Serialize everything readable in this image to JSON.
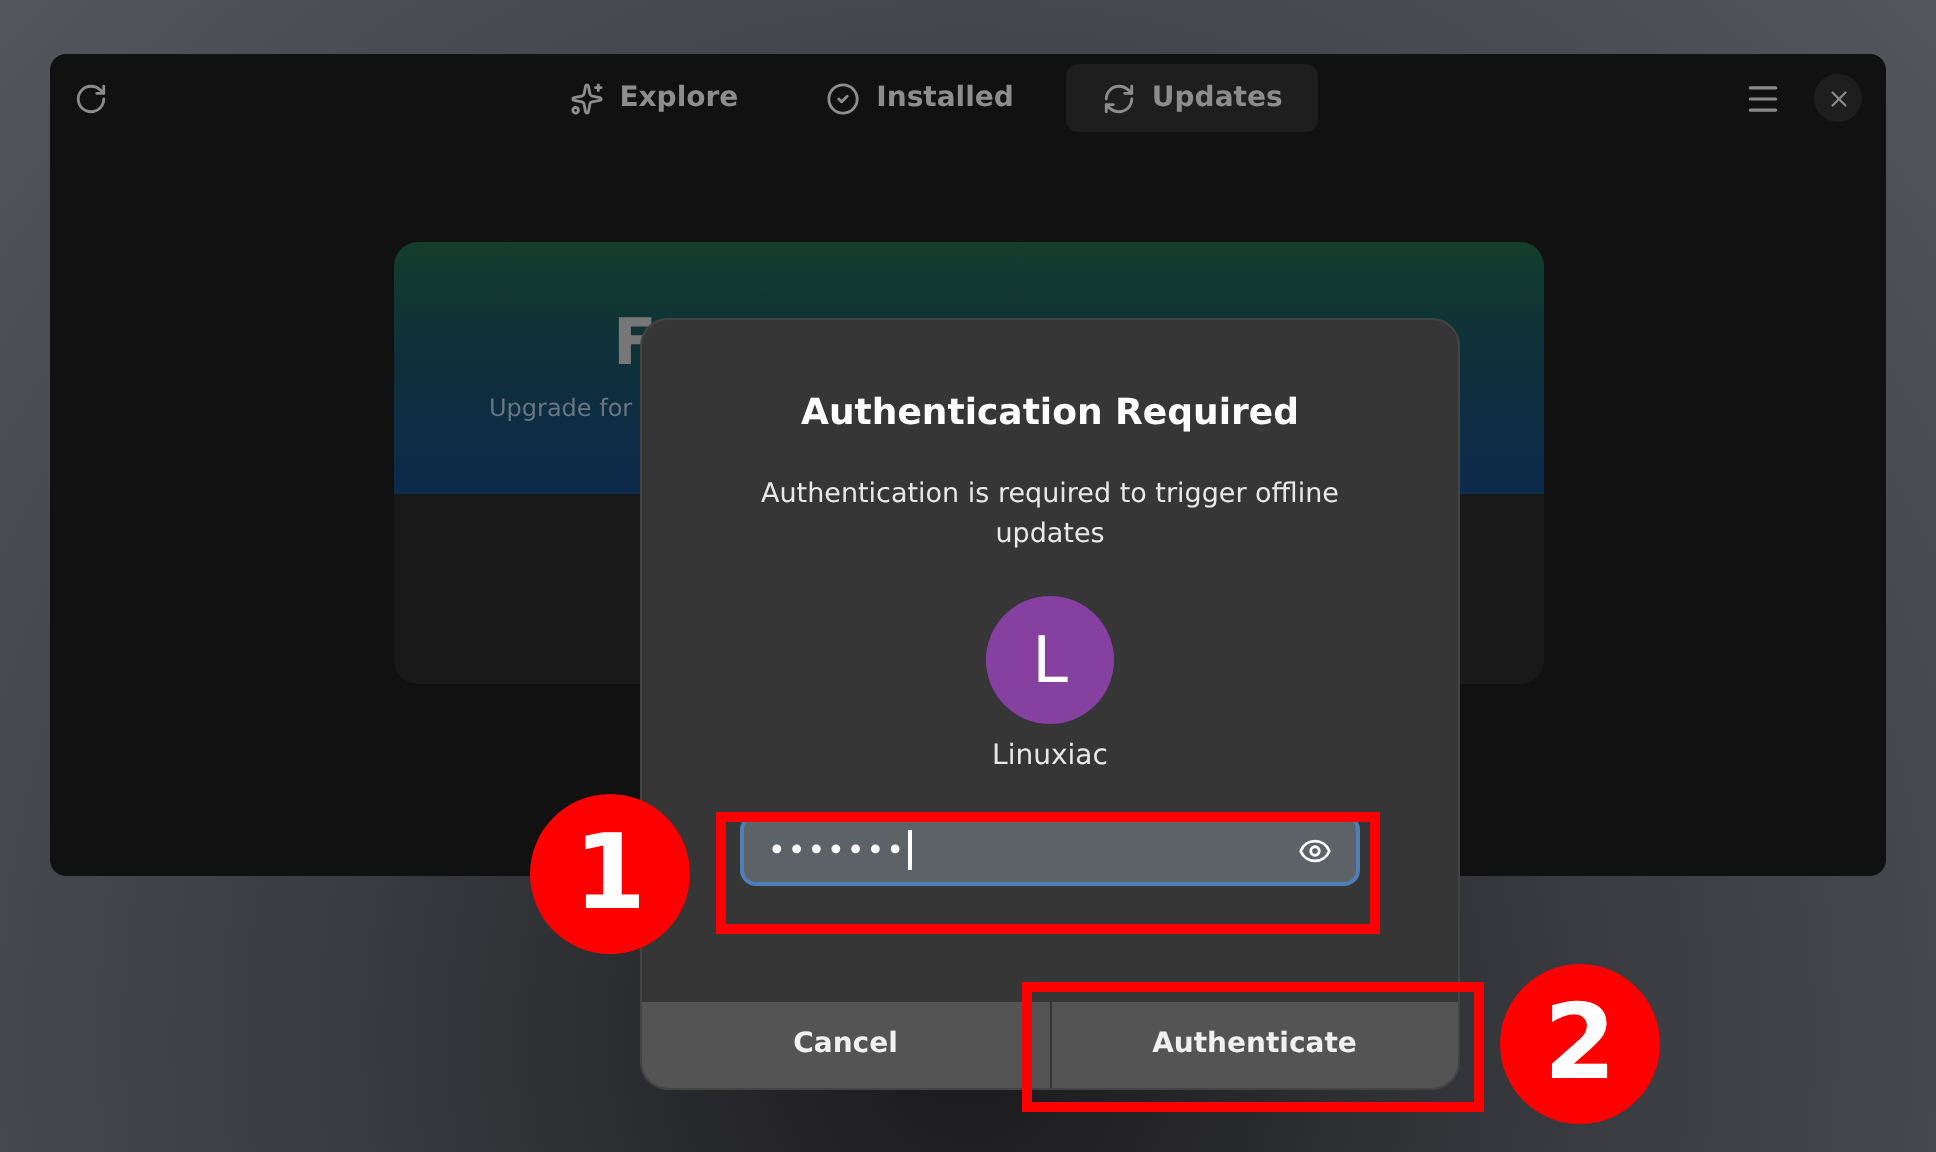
{
  "window": {
    "tabs": [
      {
        "label": "Explore",
        "selected": false
      },
      {
        "label": "Installed",
        "selected": false
      },
      {
        "label": "Updates",
        "selected": true
      }
    ],
    "banner": {
      "title": "F",
      "subtitle": "Upgrade for"
    }
  },
  "dialog": {
    "title": "Authentication Required",
    "message": "Authentication is required to trigger offline updates",
    "avatar_letter": "L",
    "user": "Linuxiac",
    "password": {
      "value": "•••••••",
      "focused": true
    },
    "buttons": [
      {
        "label": "Cancel"
      },
      {
        "label": "Authenticate"
      }
    ]
  },
  "annotations": [
    {
      "number": "1"
    },
    {
      "number": "2"
    }
  ]
}
